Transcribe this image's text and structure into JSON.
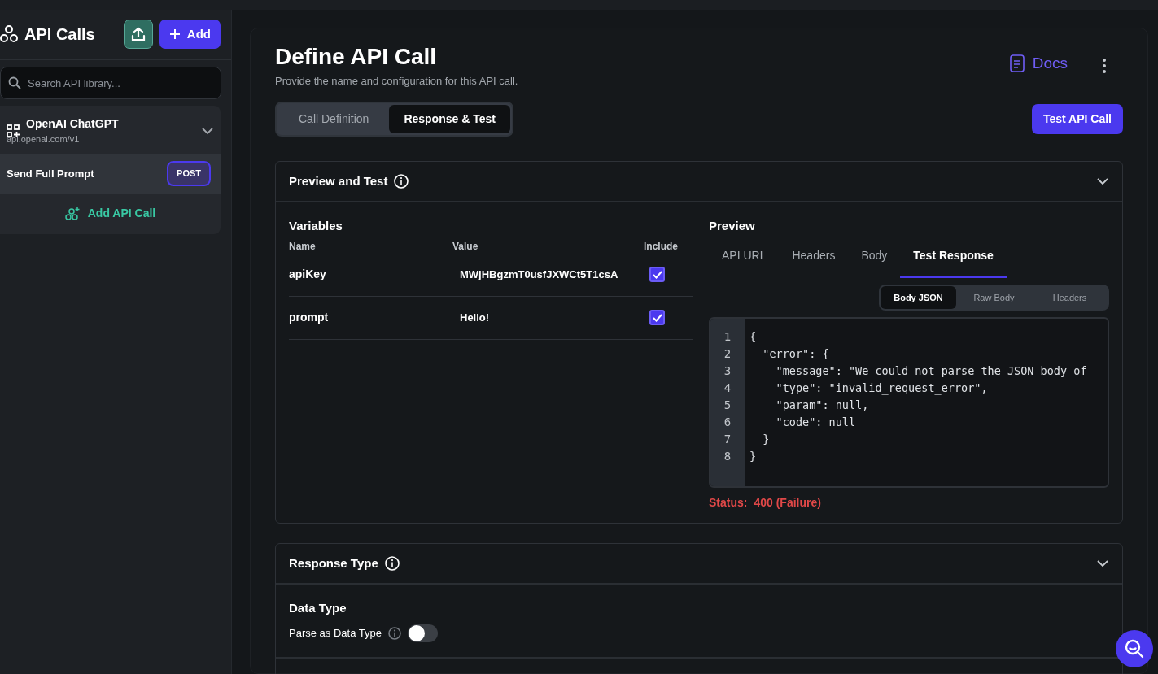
{
  "sidebar": {
    "title": "API Calls",
    "add_button": "Add",
    "search": {
      "placeholder": "Search API library..."
    },
    "groups": [
      {
        "name": "OpenAI ChatGPT",
        "url": "api.openai.com/v1",
        "expanded": true,
        "calls": [
          {
            "name": "Send Full Prompt",
            "method": "POST",
            "selected": true
          }
        ],
        "add_call": "Add API Call"
      }
    ]
  },
  "header": {
    "title": "Define API Call",
    "subtitle": "Provide the name and configuration for this API call.",
    "docs": "Docs",
    "tabs": [
      {
        "label": "Call Definition",
        "selected": false
      },
      {
        "label": "Response & Test",
        "selected": true
      }
    ],
    "test_button": "Test API Call"
  },
  "preview_and_test": {
    "title": "Preview and Test",
    "expanded": true,
    "variables": {
      "title": "Variables",
      "columns": [
        "Name",
        "Value",
        "Include"
      ],
      "rows": [
        {
          "name": "apiKey",
          "value": "MWjHBgzmT0usfJXWCt5T1csA",
          "checked": true
        },
        {
          "name": "prompt",
          "value": "Hello!",
          "checked": true
        }
      ]
    },
    "preview": {
      "title": "Preview",
      "tabs": [
        {
          "label": "API URL",
          "selected": false
        },
        {
          "label": "Headers",
          "selected": false
        },
        {
          "label": "Body",
          "selected": false
        },
        {
          "label": "Test Response",
          "selected": true
        }
      ],
      "subtabs": [
        {
          "label": "Body JSON",
          "selected": true
        },
        {
          "label": "Raw Body",
          "selected": false
        },
        {
          "label": "Headers",
          "selected": false
        }
      ],
      "code_lines": [
        {
          "number": "1",
          "text": "{"
        },
        {
          "number": "2",
          "text": "  \"error\": {"
        },
        {
          "number": "3",
          "text": "    \"message\": \"We could not parse the JSON body of"
        },
        {
          "number": "4",
          "text": "    \"type\": \"invalid_request_error\","
        },
        {
          "number": "5",
          "text": "    \"param\": null,"
        },
        {
          "number": "6",
          "text": "    \"code\": null"
        },
        {
          "number": "7",
          "text": "  }"
        },
        {
          "number": "8",
          "text": "}"
        }
      ],
      "status_label": "Status:",
      "status_value": "400 (Failure)"
    }
  },
  "response_type": {
    "title": "Response Type",
    "expanded": true,
    "data_type_title": "Data Type",
    "parse_label": "Parse as Data Type",
    "parse_on": false
  }
}
